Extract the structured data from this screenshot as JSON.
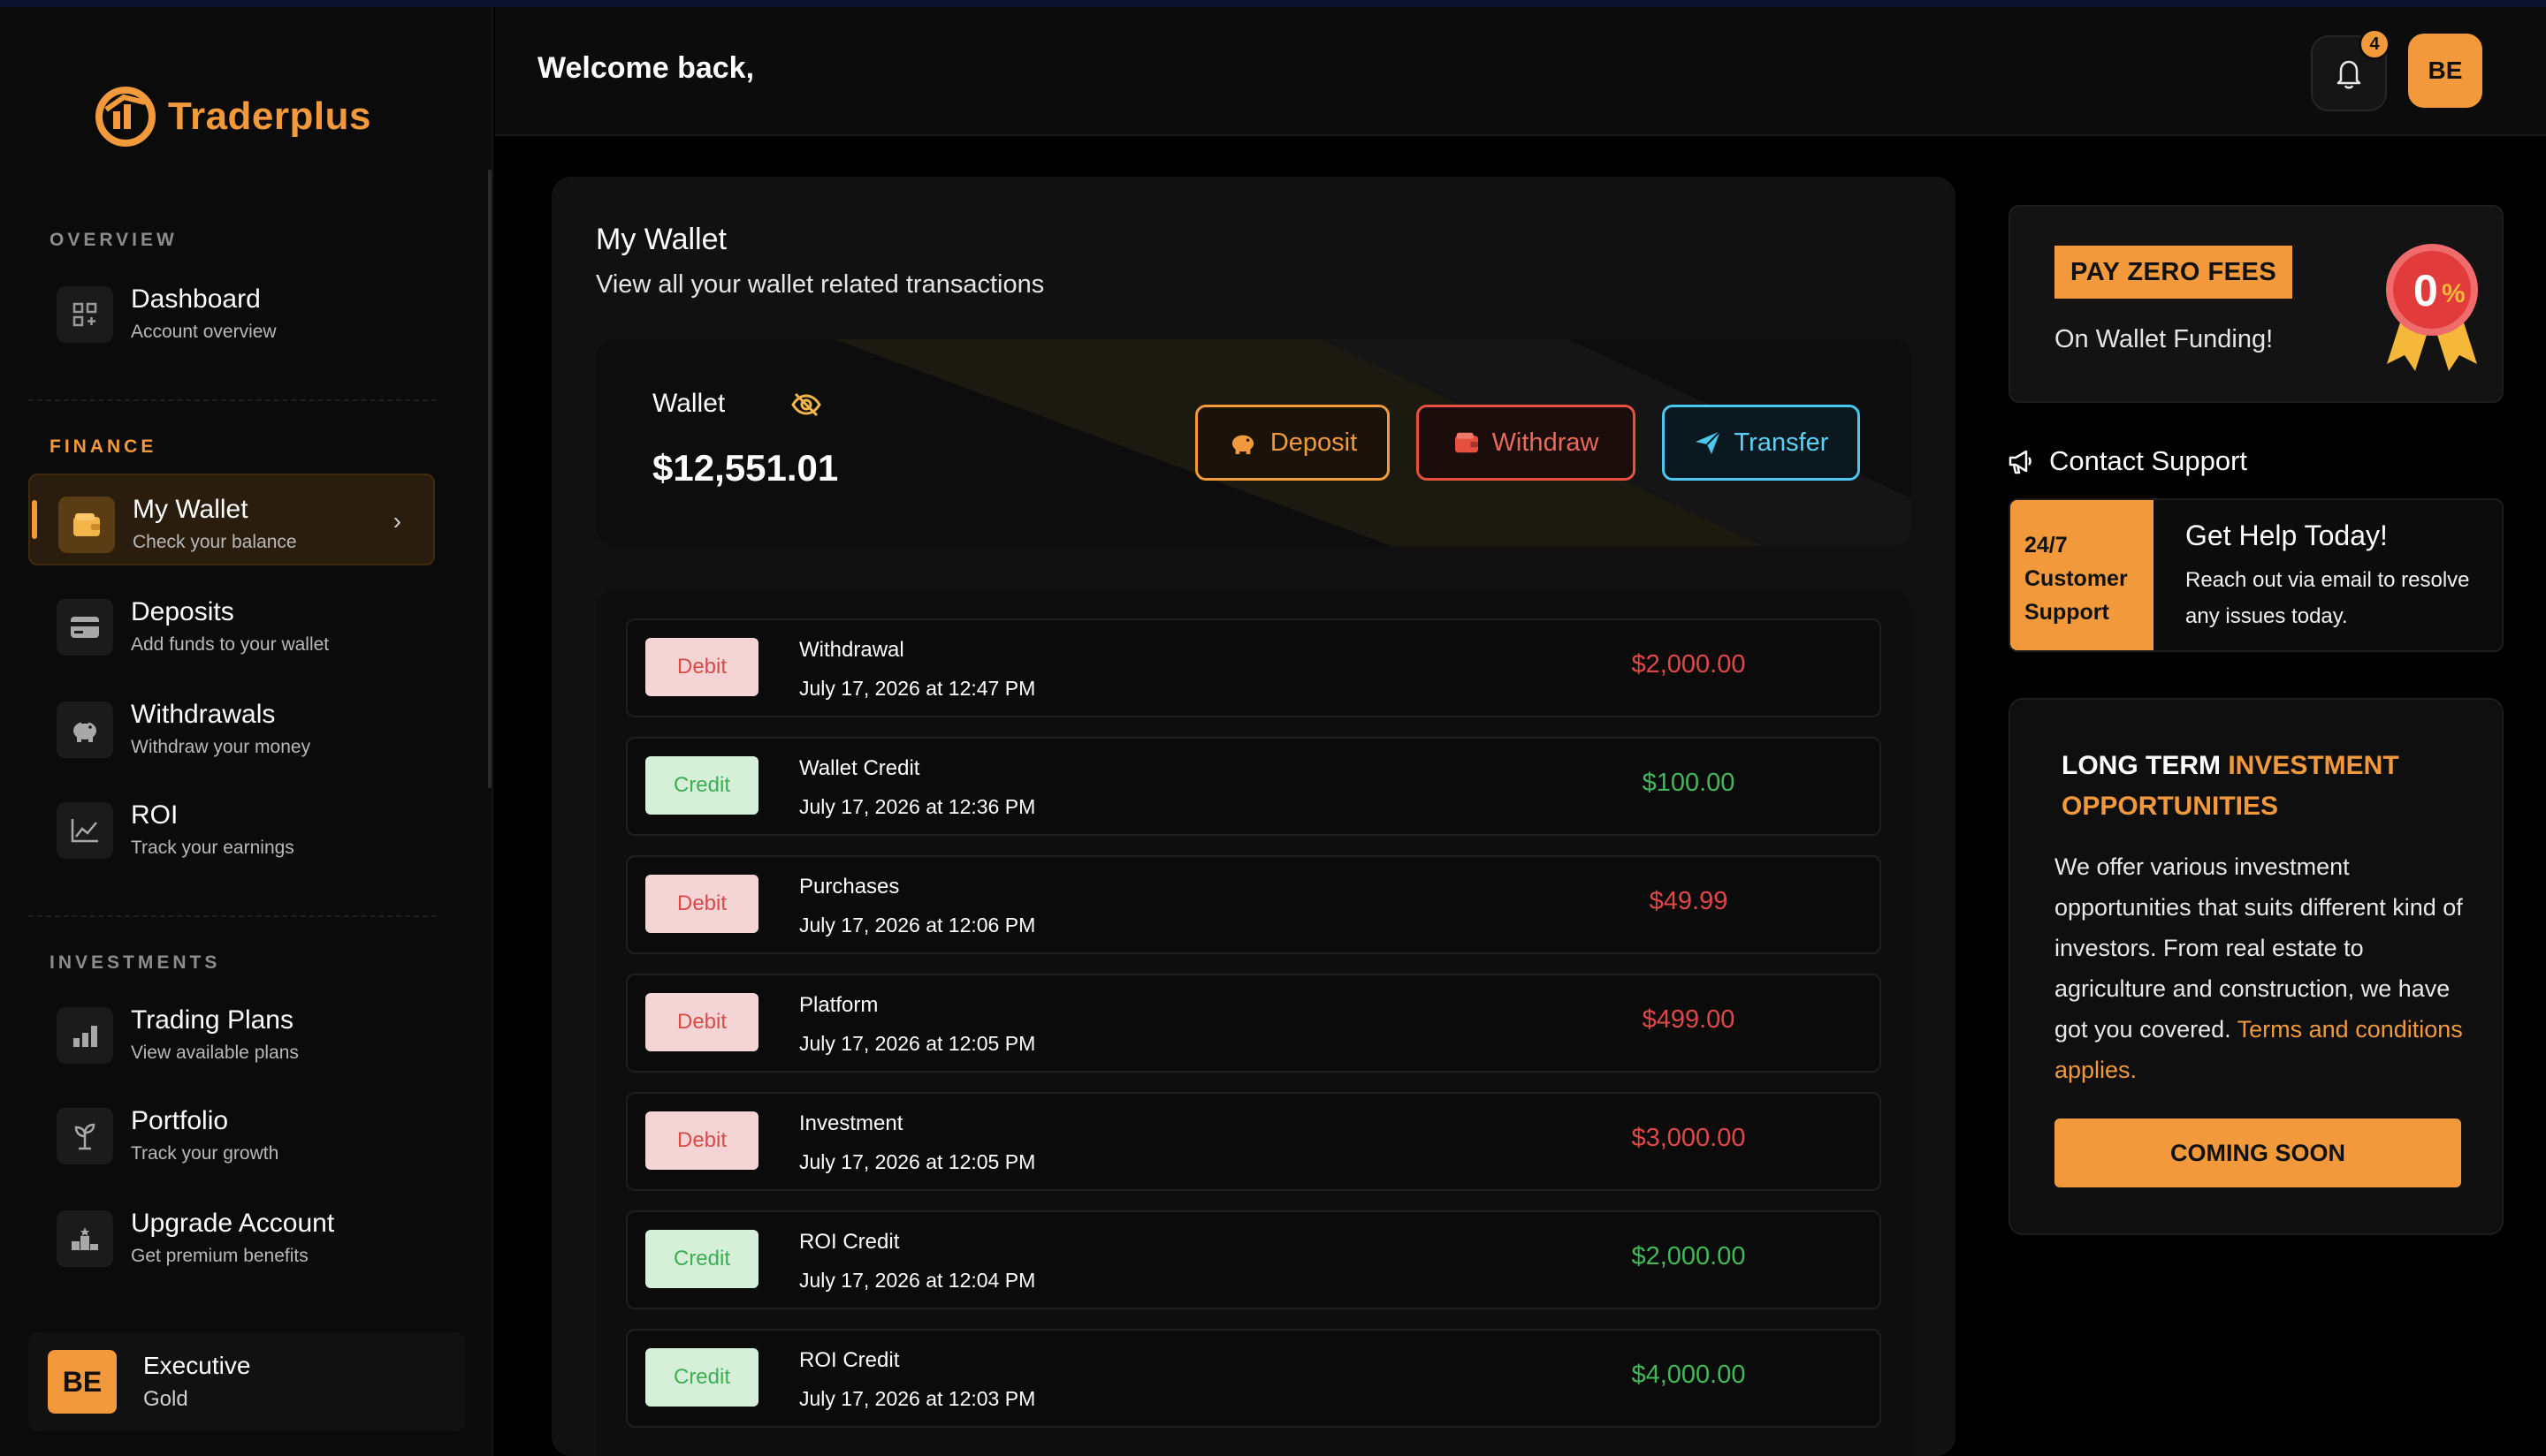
{
  "brand": {
    "name": "Traderplus",
    "accent": "#f29a3b"
  },
  "header": {
    "welcome": "Welcome back,",
    "notification_count": "4",
    "avatar_initials": "BE"
  },
  "sidebar": {
    "sections": [
      {
        "label": "OVERVIEW",
        "items": [
          {
            "title": "Dashboard",
            "sub": "Account overview",
            "icon": "dashboard-icon"
          }
        ]
      },
      {
        "label": "FINANCE",
        "items": [
          {
            "title": "My Wallet",
            "sub": "Check your balance",
            "icon": "wallet-icon",
            "active": true
          },
          {
            "title": "Deposits",
            "sub": "Add funds to your wallet",
            "icon": "card-icon"
          },
          {
            "title": "Withdrawals",
            "sub": "Withdraw your money",
            "icon": "piggy-bank-icon"
          },
          {
            "title": "ROI",
            "sub": "Track your earnings",
            "icon": "chart-line-icon"
          }
        ]
      },
      {
        "label": "INVESTMENTS",
        "items": [
          {
            "title": "Trading Plans",
            "sub": "View available plans",
            "icon": "bar-chart-icon"
          },
          {
            "title": "Portfolio",
            "sub": "Track your growth",
            "icon": "plant-icon"
          },
          {
            "title": "Upgrade Account",
            "sub": "Get premium benefits",
            "icon": "podium-icon"
          }
        ]
      }
    ],
    "user": {
      "initials": "BE",
      "name": "Executive",
      "tier": "Gold"
    }
  },
  "wallet": {
    "title": "My Wallet",
    "subtitle": "View all your wallet related transactions",
    "label": "Wallet",
    "balance": "$12,551.01",
    "buttons": {
      "deposit": "Deposit",
      "withdraw": "Withdraw",
      "transfer": "Transfer"
    }
  },
  "transactions": [
    {
      "type": "Debit",
      "name": "Withdrawal",
      "date": "July 17, 2026 at 12:47 PM",
      "amount": "$2,000.00"
    },
    {
      "type": "Credit",
      "name": "Wallet Credit",
      "date": "July 17, 2026 at 12:36 PM",
      "amount": "$100.00"
    },
    {
      "type": "Debit",
      "name": "Purchases",
      "date": "July 17, 2026 at 12:06 PM",
      "amount": "$49.99"
    },
    {
      "type": "Debit",
      "name": "Platform",
      "date": "July 17, 2026 at 12:05 PM",
      "amount": "$499.00"
    },
    {
      "type": "Debit",
      "name": "Investment",
      "date": "July 17, 2026 at 12:05 PM",
      "amount": "$3,000.00"
    },
    {
      "type": "Credit",
      "name": "ROI Credit",
      "date": "July 17, 2026 at 12:04 PM",
      "amount": "$2,000.00"
    },
    {
      "type": "Credit",
      "name": "ROI Credit",
      "date": "July 17, 2026 at 12:03 PM",
      "amount": "$4,000.00"
    }
  ],
  "promo": {
    "tag": "PAY ZERO FEES",
    "sub": "On Wallet Funding!",
    "badge_text": "0%"
  },
  "support": {
    "title": "Contact Support",
    "left_lines": [
      "24/7",
      "Customer",
      "Support"
    ],
    "heading": "Get Help Today!",
    "body": "Reach out via email to resolve any issues today."
  },
  "invest": {
    "title_white": "LONG TERM ",
    "title_accent": "INVESTMENT OPPORTUNITIES",
    "body": "We offer various investment opportunities that suits different kind of investors. From real estate to agriculture and construction, we have got you covered. ",
    "body_link": "Terms and conditions applies.",
    "button": "COMING SOON"
  }
}
